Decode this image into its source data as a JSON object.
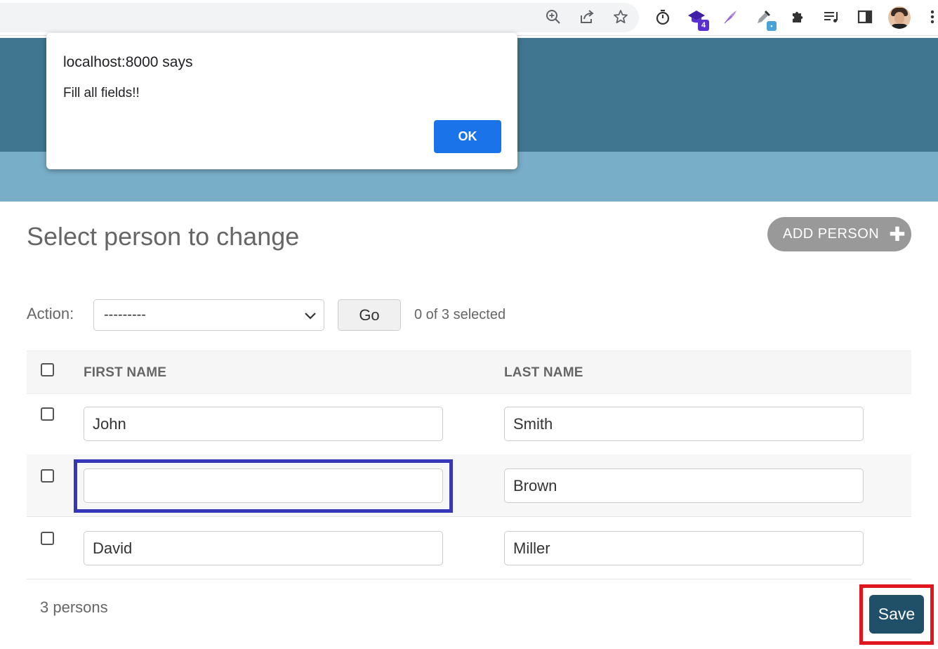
{
  "browser": {
    "toolbar_icons": [
      "zoom-icon",
      "share-icon",
      "bookmark-star-icon",
      "timer-icon",
      "extension-graduation-icon",
      "extension-feather-icon",
      "extension-eyedropper-icon",
      "extensions-puzzle-icon",
      "reading-list-icon",
      "side-panel-icon"
    ],
    "extension_badge": "4"
  },
  "dialog": {
    "title": "localhost:8000 says",
    "message": "Fill all fields!!",
    "ok_label": "OK"
  },
  "page": {
    "title": "Select person to change",
    "add_button_label": "ADD PERSON"
  },
  "actions": {
    "label": "Action:",
    "selected_option": "---------",
    "go_label": "Go",
    "selection_status": "0 of 3 selected"
  },
  "table": {
    "columns": [
      "FIRST NAME",
      "LAST NAME"
    ],
    "rows": [
      {
        "first_name": "John",
        "last_name": "Smith"
      },
      {
        "first_name": "",
        "last_name": "Brown"
      },
      {
        "first_name": "David",
        "last_name": "Miller"
      }
    ]
  },
  "footer": {
    "result_count": "3 persons",
    "save_label": "Save"
  },
  "colors": {
    "header": "#417690",
    "breadcrumb": "#79aec8",
    "save": "#205067",
    "ok_button": "#1a73e8",
    "focus_highlight": "#3636b8",
    "save_highlight": "#e0161e"
  }
}
